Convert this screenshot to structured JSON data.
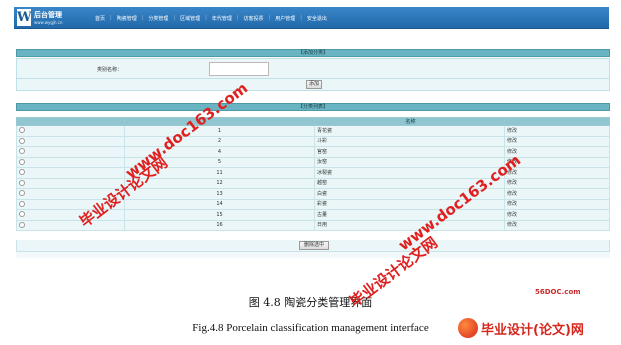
{
  "header": {
    "logo_letter": "W",
    "title": "后台管理",
    "subtitle": "www.wygjh.cn",
    "nav": [
      "首页",
      "陶瓷管理",
      "分类管理",
      "区域管理",
      "年代管理",
      "访客投票",
      "用户管理",
      "安全退出"
    ]
  },
  "add_panel": {
    "title": "【添加分类】",
    "field_label": "类别名称：",
    "field_value": "",
    "submit_label": "添加"
  },
  "list_panel": {
    "title": "【分类列表】",
    "columns": [
      "",
      "",
      "名称",
      ""
    ],
    "rows": [
      {
        "id": "1",
        "name": "青花瓷",
        "op": "修改"
      },
      {
        "id": "2",
        "name": "斗彩",
        "op": "修改"
      },
      {
        "id": "4",
        "name": "官窑",
        "op": "修改"
      },
      {
        "id": "5",
        "name": "汝窑",
        "op": "修改"
      },
      {
        "id": "11",
        "name": "冰裂瓷",
        "op": "修改"
      },
      {
        "id": "12",
        "name": "越窑",
        "op": "修改"
      },
      {
        "id": "13",
        "name": "白瓷",
        "op": "修改"
      },
      {
        "id": "14",
        "name": "彩瓷",
        "op": "修改"
      },
      {
        "id": "15",
        "name": "古董",
        "op": "修改"
      },
      {
        "id": "16",
        "name": "日用",
        "op": "修改"
      }
    ],
    "delete_label": "删除选中"
  },
  "caption": {
    "cn": "图 4.8 陶瓷分类管理界面",
    "en": "Fig.4.8 Porcelain classification management interface"
  },
  "watermark": {
    "text1": "毕业设计论文网",
    "text2": "www.doc163.com",
    "site": "56DOC.com",
    "brand": "毕业设计(论文)网"
  },
  "colors": {
    "header": "#2a74b8",
    "panel_head": "#69b4c2",
    "row_bg": "#eaf6f8",
    "watermark": "#e0201f"
  }
}
